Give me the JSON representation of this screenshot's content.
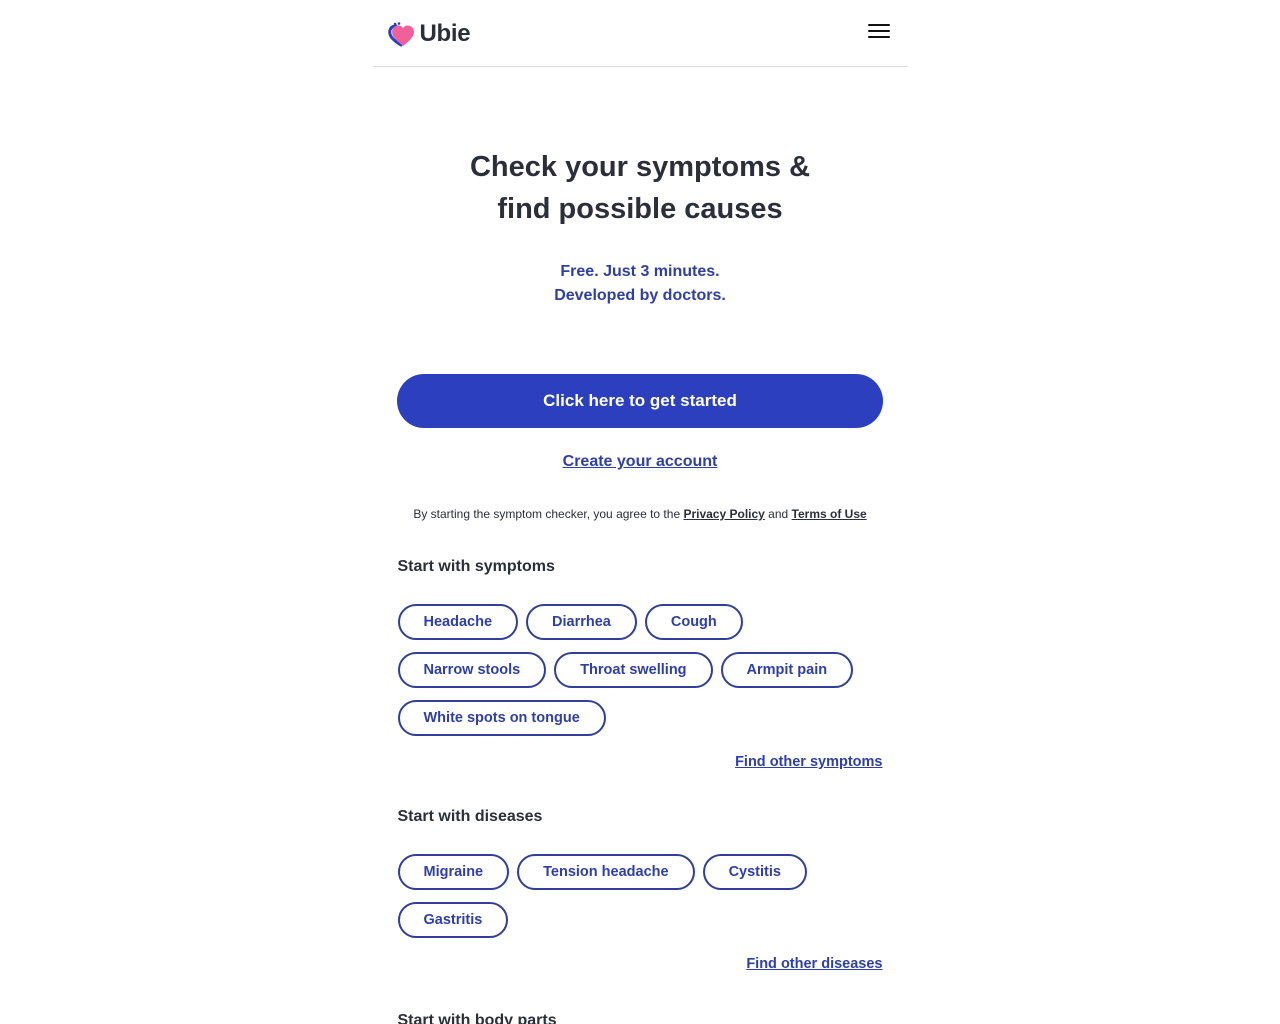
{
  "header": {
    "brand": "Ubie",
    "logo_icon": "heart-logo-icon",
    "menu_icon": "hamburger-menu-icon"
  },
  "hero": {
    "title_line1": "Check your symptoms &",
    "title_line2": "find possible causes",
    "subtitle_line1": "Free. Just 3 minutes.",
    "subtitle_line2": "Developed by doctors."
  },
  "cta": {
    "start_label": "Click here to get started",
    "account_label": "Create your account"
  },
  "terms": {
    "prefix": "By starting the symptom checker, you agree to the ",
    "privacy_label": "Privacy Policy",
    "middle": " and ",
    "terms_label": "Terms of Use"
  },
  "symptoms": {
    "title": "Start with symptoms",
    "items": [
      "Headache",
      "Diarrhea",
      "Cough",
      "Narrow stools",
      "Throat swelling",
      "Armpit pain",
      "White spots on tongue"
    ],
    "more_label": "Find other symptoms"
  },
  "diseases": {
    "title": "Start with diseases",
    "items": [
      "Migraine",
      "Tension headache",
      "Cystitis",
      "Gastritis"
    ],
    "more_label": "Find other diseases"
  },
  "body_parts": {
    "title": "Start with body parts"
  },
  "colors": {
    "primary": "#2b3fbf",
    "link": "#2f3fa8",
    "text": "#2b2f3a",
    "logo_pink": "#f0609a"
  }
}
